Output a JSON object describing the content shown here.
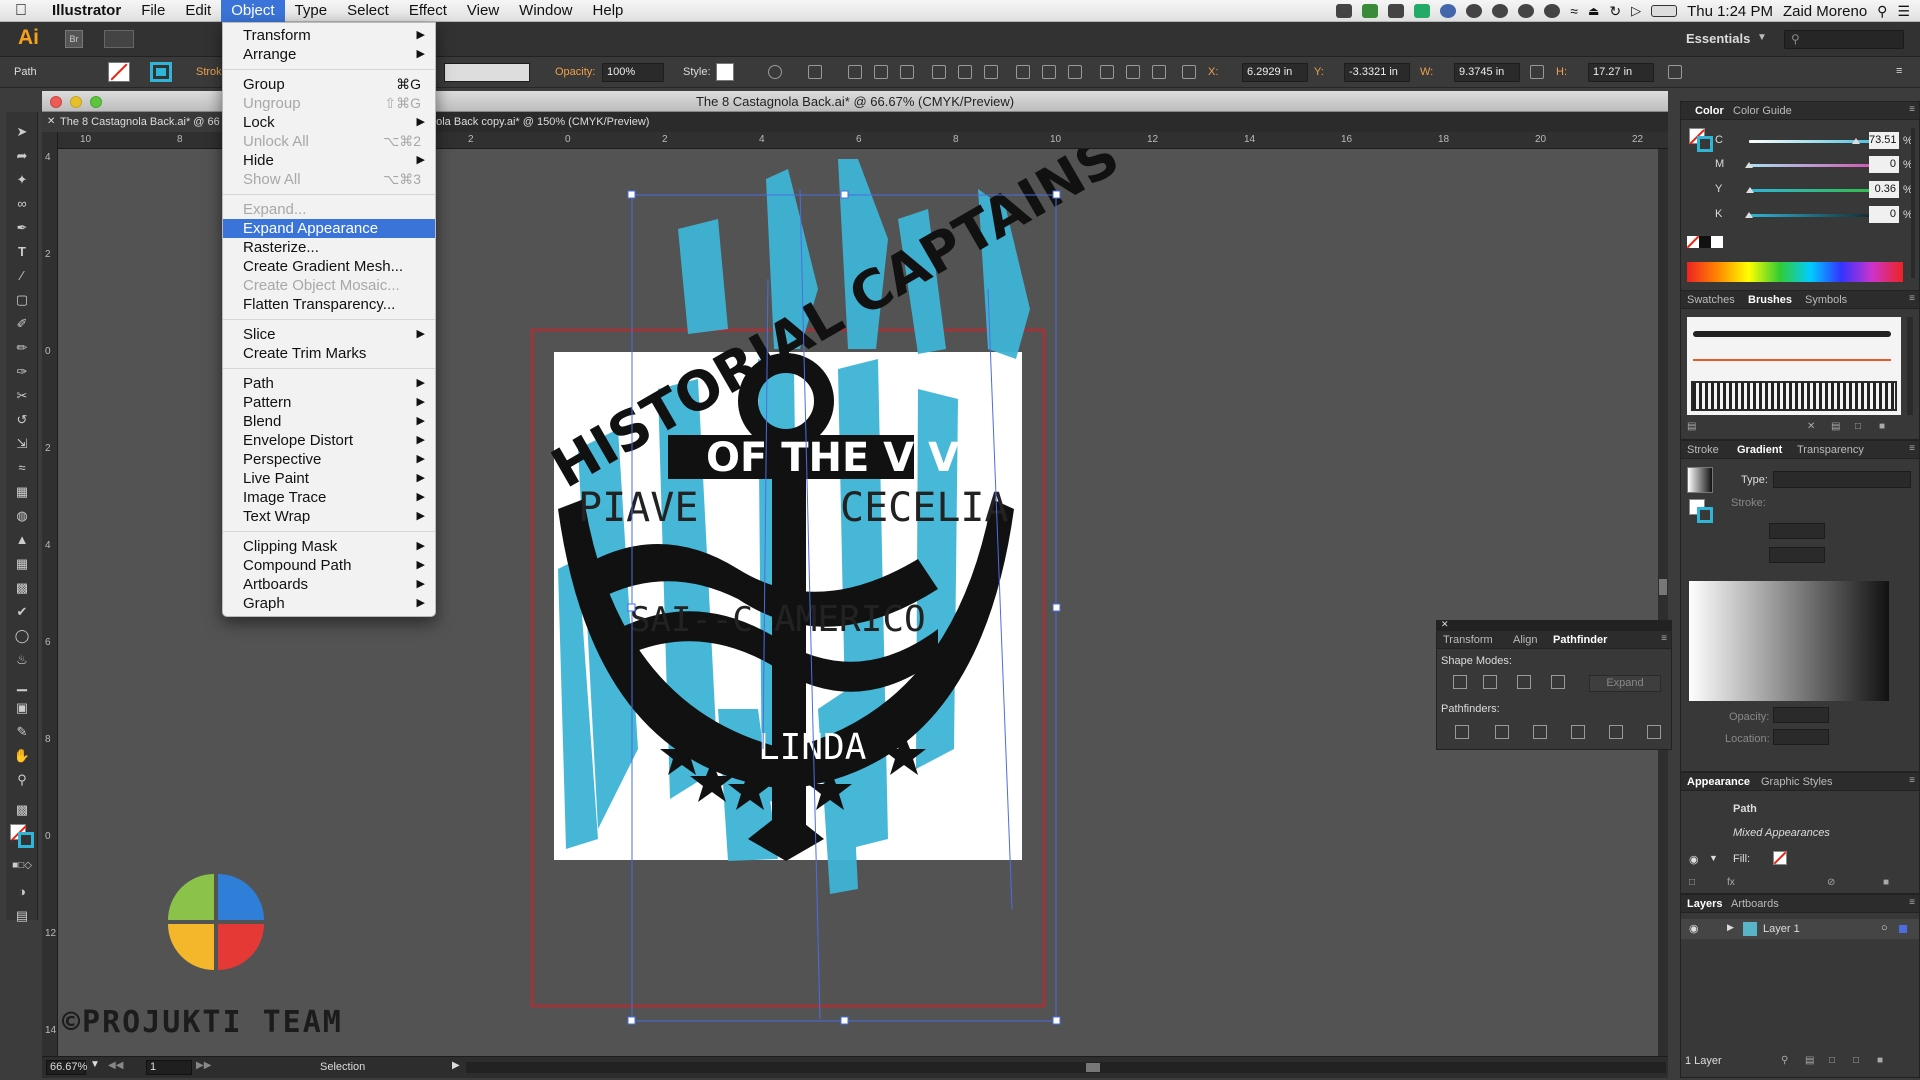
{
  "menubar": {
    "app_name": "Illustrator",
    "items": [
      "File",
      "Edit",
      "Object",
      "Type",
      "Select",
      "Effect",
      "View",
      "Window",
      "Help"
    ],
    "active": "Object",
    "clock": "Thu 1:24 PM",
    "user": "Zaid Moreno"
  },
  "appbar": {
    "logo": "Ai",
    "bridge": "Br",
    "workspace": "Essentials"
  },
  "controlbar": {
    "selection_type": "Path",
    "stroke_label": "Stroke",
    "opacity_label": "Opacity:",
    "opacity_value": "100%",
    "style_label": "Style:",
    "x_label": "X:",
    "x_value": "6.2929 in",
    "y_label": "Y:",
    "y_value": "-3.3321 in",
    "w_label": "W:",
    "w_value": "9.3745 in",
    "h_label": "H:",
    "h_value": "17.27 in"
  },
  "document": {
    "title": "The 8 Castagnola Back.ai* @ 66.67% (CMYK/Preview)",
    "tabs": [
      "The 8 Castagnola Back.ai* @ 66.67% (CMYK/Preview)",
      "The 8 Castagnola Back copy.ai* @ 150% (CMYK/Preview)"
    ],
    "tab_visible_fragments": [
      "The 8 Castagnola Back.ai* @ 66",
      "nola Back copy.ai* @ 150% (CMYK/Preview)"
    ],
    "ruler_h": [
      "10",
      "8",
      "6",
      "4",
      "2",
      "0",
      "2",
      "4",
      "6",
      "8",
      "10",
      "12",
      "14",
      "16",
      "18",
      "20",
      "22"
    ],
    "ruler_v": [
      "4",
      "2",
      "0",
      "2",
      "4",
      "6",
      "8",
      "0",
      "12",
      "14"
    ]
  },
  "artwork": {
    "arc_text": "HISTORIAL CAPTAINS",
    "banner_text": "OF THE V V",
    "left_text": "PIAVE",
    "right_text": "CECELIA",
    "lower_left_text": "SAI--C",
    "lower_right_text": "AMERICO",
    "bottom_text": "LINDA"
  },
  "object_menu": [
    {
      "label": "Transform",
      "arrow": true
    },
    {
      "label": "Arrange",
      "arrow": true
    },
    {
      "sep": true
    },
    {
      "label": "Group",
      "shortcut": "⌘G"
    },
    {
      "label": "Ungroup",
      "shortcut": "⇧⌘G",
      "disabled": true
    },
    {
      "label": "Lock",
      "arrow": true
    },
    {
      "label": "Unlock All",
      "shortcut": "⌥⌘2",
      "disabled": true
    },
    {
      "label": "Hide",
      "arrow": true
    },
    {
      "label": "Show All",
      "shortcut": "⌥⌘3",
      "disabled": true
    },
    {
      "sep": true
    },
    {
      "label": "Expand...",
      "disabled": true
    },
    {
      "label": "Expand Appearance",
      "highlight": true
    },
    {
      "label": "Rasterize..."
    },
    {
      "label": "Create Gradient Mesh..."
    },
    {
      "label": "Create Object Mosaic...",
      "disabled": true
    },
    {
      "label": "Flatten Transparency..."
    },
    {
      "sep": true
    },
    {
      "label": "Slice",
      "arrow": true
    },
    {
      "label": "Create Trim Marks"
    },
    {
      "sep": true
    },
    {
      "label": "Path",
      "arrow": true
    },
    {
      "label": "Pattern",
      "arrow": true
    },
    {
      "label": "Blend",
      "arrow": true
    },
    {
      "label": "Envelope Distort",
      "arrow": true
    },
    {
      "label": "Perspective",
      "arrow": true
    },
    {
      "label": "Live Paint",
      "arrow": true
    },
    {
      "label": "Image Trace",
      "arrow": true
    },
    {
      "label": "Text Wrap",
      "arrow": true
    },
    {
      "sep": true
    },
    {
      "label": "Clipping Mask",
      "arrow": true
    },
    {
      "label": "Compound Path",
      "arrow": true
    },
    {
      "label": "Artboards",
      "arrow": true
    },
    {
      "label": "Graph",
      "arrow": true
    }
  ],
  "color_panel": {
    "tabs": [
      "Color",
      "Color Guide"
    ],
    "channels": [
      {
        "name": "C",
        "value": "73.51",
        "fraction": 0.7351,
        "color": "#2fb5d8"
      },
      {
        "name": "M",
        "value": "0",
        "fraction": 0,
        "color": "#d63ea6"
      },
      {
        "name": "Y",
        "value": "0.36",
        "fraction": 0.0036,
        "color": "#30c030"
      },
      {
        "name": "K",
        "value": "0",
        "fraction": 0,
        "color": "#111111"
      }
    ],
    "unit": "%"
  },
  "brushes_panel": {
    "tabs": [
      "Swatches",
      "Brushes",
      "Symbols"
    ]
  },
  "gradient_panel": {
    "tabs": [
      "Stroke",
      "Gradient",
      "Transparency"
    ],
    "type_label": "Type:",
    "stroke_label": "Stroke:",
    "opacity_label": "Opacity:",
    "location_label": "Location:"
  },
  "pathfinder_panel": {
    "tabs": [
      "Transform",
      "Align",
      "Pathfinder"
    ],
    "shape_modes": "Shape Modes:",
    "pathfinders": "Pathfinders:",
    "expand": "Expand"
  },
  "appearance_panel": {
    "tabs": [
      "Appearance",
      "Graphic Styles"
    ],
    "object": "Path",
    "mixed": "Mixed Appearances",
    "fill_label": "Fill:"
  },
  "layers_panel": {
    "tabs": [
      "Layers",
      "Artboards"
    ],
    "layer": "Layer 1",
    "count": "1 Layer"
  },
  "statusbar": {
    "zoom": "66.67%",
    "artboard": "1",
    "tool": "Selection"
  },
  "watermark": {
    "text": "©PROJUKTI TEAM"
  }
}
